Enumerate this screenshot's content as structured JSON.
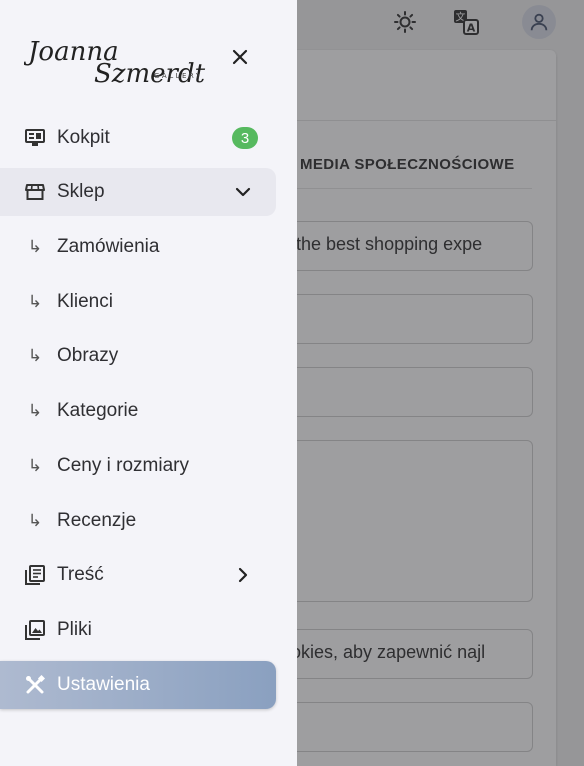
{
  "background": {
    "tab_social": "MEDIA SPOŁECZNOŚCIOWE",
    "field_1": "u the best shopping expe",
    "field_5": "ookies, aby zapewnić najl"
  },
  "drawer": {
    "logo_script": "Joanna Szmerdt",
    "logo_sub": "GALLERY",
    "close_icon": "close-icon",
    "items": [
      {
        "label": "Kokpit",
        "icon": "dashboard-icon",
        "badge": "3"
      },
      {
        "label": "Sklep",
        "icon": "store-icon",
        "expanded": true
      },
      {
        "label": "Zamówienia",
        "icon": "subdirectory-arrow-icon"
      },
      {
        "label": "Klienci",
        "icon": "subdirectory-arrow-icon"
      },
      {
        "label": "Obrazy",
        "icon": "subdirectory-arrow-icon"
      },
      {
        "label": "Kategorie",
        "icon": "subdirectory-arrow-icon"
      },
      {
        "label": "Ceny i rozmiary",
        "icon": "subdirectory-arrow-icon"
      },
      {
        "label": "Recenzje",
        "icon": "subdirectory-arrow-icon"
      },
      {
        "label": "Treść",
        "icon": "article-icon"
      },
      {
        "label": "Pliki",
        "icon": "images-icon"
      },
      {
        "label": "Ustawienia",
        "icon": "tools-icon",
        "active": true
      }
    ]
  },
  "colors": {
    "active_start": "#aebad0",
    "active_end": "#8aa0c0",
    "badge": "#56b95f",
    "drawer_bg": "#f4f4f9"
  }
}
